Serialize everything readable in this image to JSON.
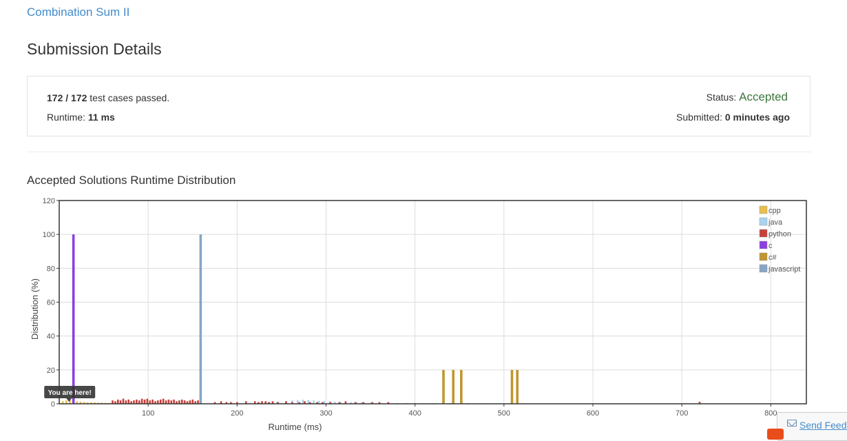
{
  "problem": {
    "title": "Combination Sum II"
  },
  "page": {
    "title": "Submission Details"
  },
  "details": {
    "passed": "172",
    "total": "172",
    "passed_suffix": "test cases passed.",
    "runtime_label": "Runtime:",
    "runtime_value": "11 ms",
    "status_label": "Status:",
    "status_value": "Accepted",
    "submitted_label": "Submitted:",
    "submitted_value": "0 minutes ago",
    "status_color": "#3c763d"
  },
  "chart_title": "Accepted Solutions Runtime Distribution",
  "chart_data": {
    "type": "bar",
    "xlabel": "Runtime (ms)",
    "ylabel": "Distribution (%)",
    "xlim": [
      0,
      840
    ],
    "ylim": [
      0,
      120
    ],
    "xticks": [
      100,
      200,
      300,
      400,
      500,
      600,
      700,
      800
    ],
    "yticks": [
      0,
      20,
      40,
      60,
      80,
      100,
      120
    ],
    "grid": true,
    "legend_position": "top-right",
    "annotation": {
      "text": "You are here!",
      "x": 11
    },
    "series": [
      {
        "name": "cpp",
        "color": "#ebbd4b",
        "points": [
          [
            4,
            1.5
          ],
          [
            8,
            2
          ],
          [
            12,
            2.2
          ],
          [
            16,
            1.8
          ],
          [
            20,
            1.5
          ],
          [
            24,
            1.2
          ],
          [
            28,
            1
          ],
          [
            32,
            0.9
          ],
          [
            36,
            0.8
          ],
          [
            40,
            0.8
          ],
          [
            44,
            0.7
          ],
          [
            48,
            0.7
          ],
          [
            52,
            0.6
          ],
          [
            56,
            0.5
          ],
          [
            60,
            0.5
          ],
          [
            66,
            0.4
          ],
          [
            72,
            0.4
          ],
          [
            80,
            0.3
          ],
          [
            90,
            0.3
          ],
          [
            100,
            0.3
          ],
          [
            120,
            0.2
          ],
          [
            140,
            0.2
          ],
          [
            160,
            0.2
          ],
          [
            180,
            0.2
          ],
          [
            220,
            0.2
          ],
          [
            260,
            0.2
          ]
        ]
      },
      {
        "name": "java",
        "color": "#a9d3f0",
        "points": [
          [
            200,
            0.5
          ],
          [
            215,
            0.6
          ],
          [
            225,
            0.8
          ],
          [
            235,
            1
          ],
          [
            245,
            1.2
          ],
          [
            255,
            1.5
          ],
          [
            262,
            2
          ],
          [
            268,
            2.2
          ],
          [
            274,
            2.4
          ],
          [
            280,
            2.2
          ],
          [
            286,
            2
          ],
          [
            292,
            1.8
          ],
          [
            298,
            1.6
          ],
          [
            304,
            1.4
          ],
          [
            310,
            1.3
          ],
          [
            316,
            1.2
          ],
          [
            322,
            1.1
          ],
          [
            328,
            1
          ],
          [
            334,
            0.9
          ],
          [
            340,
            0.8
          ],
          [
            350,
            0.7
          ],
          [
            360,
            0.6
          ],
          [
            370,
            0.6
          ],
          [
            380,
            0.5
          ],
          [
            390,
            0.5
          ],
          [
            400,
            0.5
          ],
          [
            410,
            0.4
          ],
          [
            420,
            0.4
          ],
          [
            440,
            0.4
          ],
          [
            460,
            0.4
          ],
          [
            480,
            0.3
          ],
          [
            500,
            0.3
          ],
          [
            520,
            0.3
          ],
          [
            540,
            0.2
          ],
          [
            560,
            0.2
          ],
          [
            580,
            0.2
          ],
          [
            600,
            0.2
          ],
          [
            620,
            0.2
          ]
        ]
      },
      {
        "name": "python",
        "color": "#c9403b",
        "points": [
          [
            60,
            2
          ],
          [
            63,
            1.5
          ],
          [
            66,
            2.5
          ],
          [
            69,
            2
          ],
          [
            72,
            3
          ],
          [
            75,
            2
          ],
          [
            78,
            2.5
          ],
          [
            81,
            1.5
          ],
          [
            84,
            2
          ],
          [
            87,
            2.5
          ],
          [
            90,
            2
          ],
          [
            93,
            3
          ],
          [
            96,
            2.5
          ],
          [
            99,
            3
          ],
          [
            102,
            2
          ],
          [
            105,
            2.5
          ],
          [
            108,
            1.5
          ],
          [
            111,
            2
          ],
          [
            114,
            2.5
          ],
          [
            117,
            3
          ],
          [
            120,
            2
          ],
          [
            123,
            2.5
          ],
          [
            126,
            2
          ],
          [
            129,
            2.5
          ],
          [
            132,
            1.5
          ],
          [
            135,
            2
          ],
          [
            138,
            2.5
          ],
          [
            141,
            2
          ],
          [
            144,
            1.5
          ],
          [
            147,
            2
          ],
          [
            150,
            2.5
          ],
          [
            153,
            1.5
          ],
          [
            156,
            2
          ],
          [
            159,
            1.5
          ],
          [
            175,
            1
          ],
          [
            182,
            1.5
          ],
          [
            188,
            1
          ],
          [
            193,
            1
          ],
          [
            200,
            1
          ],
          [
            210,
            1.5
          ],
          [
            220,
            1.5
          ],
          [
            224,
            1
          ],
          [
            228,
            1.5
          ],
          [
            232,
            1.5
          ],
          [
            236,
            1
          ],
          [
            240,
            1.5
          ],
          [
            246,
            1
          ],
          [
            255,
            1.5
          ],
          [
            262,
            1
          ],
          [
            270,
            1
          ],
          [
            276,
            1.5
          ],
          [
            282,
            1
          ],
          [
            290,
            1
          ],
          [
            296,
            1
          ],
          [
            305,
            1
          ],
          [
            315,
            1
          ],
          [
            322,
            1.5
          ],
          [
            333,
            1
          ],
          [
            342,
            1
          ],
          [
            352,
            1
          ],
          [
            360,
            1
          ],
          [
            370,
            1
          ],
          [
            720,
            1.2
          ]
        ]
      },
      {
        "name": "c",
        "color": "#8b3fe0",
        "points": [
          [
            16,
            100
          ]
        ]
      },
      {
        "name": "c#",
        "color": "#c1962f",
        "points": [
          [
            432,
            20
          ],
          [
            443,
            20
          ],
          [
            452,
            20
          ],
          [
            509,
            20
          ],
          [
            515,
            20
          ]
        ]
      },
      {
        "name": "javascript",
        "color": "#88a6c4",
        "points": [
          [
            159,
            100
          ]
        ]
      }
    ]
  },
  "feedback": {
    "label": "Send Feedback"
  }
}
